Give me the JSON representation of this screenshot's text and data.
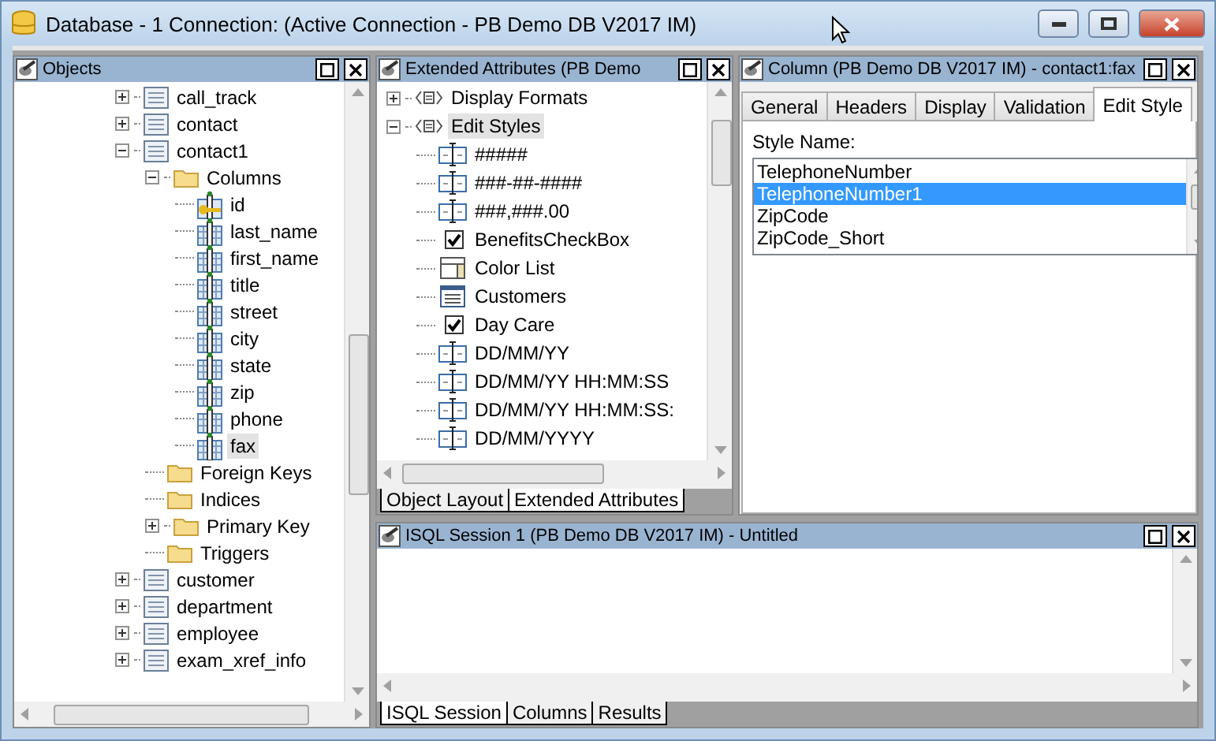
{
  "window": {
    "title": "Database - 1 Connection: (Active Connection - PB Demo DB V2017 IM)"
  },
  "objects_panel": {
    "title": "Objects",
    "tree": [
      {
        "label": "call_track",
        "kind": "table",
        "expanded": false,
        "selected": false
      },
      {
        "label": "contact",
        "kind": "table",
        "expanded": false,
        "selected": false
      },
      {
        "label": "contact1",
        "kind": "table",
        "expanded": true,
        "selected": false,
        "children": [
          {
            "label": "Columns",
            "kind": "folder",
            "expanded": true,
            "selected": false,
            "children": [
              {
                "label": "id",
                "kind": "key-column",
                "selected": false
              },
              {
                "label": "last_name",
                "kind": "column",
                "selected": false
              },
              {
                "label": "first_name",
                "kind": "column",
                "selected": false
              },
              {
                "label": "title",
                "kind": "column",
                "selected": false
              },
              {
                "label": "street",
                "kind": "column",
                "selected": false
              },
              {
                "label": "city",
                "kind": "column",
                "selected": false
              },
              {
                "label": "state",
                "kind": "column",
                "selected": false
              },
              {
                "label": "zip",
                "kind": "column",
                "selected": false
              },
              {
                "label": "phone",
                "kind": "column",
                "selected": false
              },
              {
                "label": "fax",
                "kind": "column",
                "selected": true
              }
            ]
          },
          {
            "label": "Foreign Keys",
            "kind": "folder",
            "selected": false
          },
          {
            "label": "Indices",
            "kind": "folder",
            "selected": false
          },
          {
            "label": "Primary Key",
            "kind": "folder",
            "expanded": false,
            "selected": false
          },
          {
            "label": "Triggers",
            "kind": "folder",
            "selected": false
          }
        ]
      },
      {
        "label": "customer",
        "kind": "table",
        "expanded": false,
        "selected": false
      },
      {
        "label": "department",
        "kind": "table",
        "expanded": false,
        "selected": false
      },
      {
        "label": "employee",
        "kind": "table",
        "expanded": false,
        "selected": false
      },
      {
        "label": "exam_xref_info",
        "kind": "table",
        "expanded": false,
        "selected": false
      }
    ]
  },
  "extended_attributes_panel": {
    "title": "Extended Attributes (PB Demo",
    "tree": [
      {
        "label": "Display Formats",
        "kind": "group",
        "expanded": false,
        "selected": false
      },
      {
        "label": "Edit Styles",
        "kind": "group",
        "expanded": true,
        "selected": true,
        "children": [
          {
            "label": "#####",
            "kind": "edit-mask",
            "selected": false
          },
          {
            "label": "###-##-####",
            "kind": "edit-mask",
            "selected": false
          },
          {
            "label": "###,###.00",
            "kind": "edit-mask",
            "selected": false
          },
          {
            "label": "BenefitsCheckBox",
            "kind": "checkbox",
            "selected": false
          },
          {
            "label": "Color List",
            "kind": "dropdown",
            "selected": false
          },
          {
            "label": "Customers",
            "kind": "list",
            "selected": false
          },
          {
            "label": "Day Care",
            "kind": "checkbox",
            "selected": false
          },
          {
            "label": "DD/MM/YY",
            "kind": "edit-mask",
            "selected": false
          },
          {
            "label": "DD/MM/YY HH:MM:SS",
            "kind": "edit-mask",
            "selected": false
          },
          {
            "label": "DD/MM/YY HH:MM:SS:",
            "kind": "edit-mask",
            "selected": false
          },
          {
            "label": "DD/MM/YYYY",
            "kind": "edit-mask",
            "selected": false
          }
        ]
      }
    ],
    "tabs": [
      {
        "label": "Object Layout",
        "selected": false
      },
      {
        "label": "Extended Attributes",
        "selected": true
      }
    ]
  },
  "column_panel": {
    "title": "Column (PB Demo DB V2017 IM) - contact1:fax",
    "tabs": [
      {
        "label": "General",
        "selected": false
      },
      {
        "label": "Headers",
        "selected": false
      },
      {
        "label": "Display",
        "selected": false
      },
      {
        "label": "Validation",
        "selected": false
      },
      {
        "label": "Edit Style",
        "selected": true
      }
    ],
    "style_name_label": "Style Name:",
    "style_names": [
      {
        "label": "TelephoneNumber",
        "selected": false
      },
      {
        "label": "TelephoneNumber1",
        "selected": true
      },
      {
        "label": "ZipCode",
        "selected": false
      },
      {
        "label": "ZipCode_Short",
        "selected": false
      }
    ]
  },
  "isql_panel": {
    "title": "ISQL Session 1 (PB Demo DB V2017 IM) - Untitled",
    "tabs": [
      {
        "label": "ISQL Session",
        "selected": true
      },
      {
        "label": "Columns",
        "selected": false
      },
      {
        "label": "Results",
        "selected": false
      }
    ]
  }
}
